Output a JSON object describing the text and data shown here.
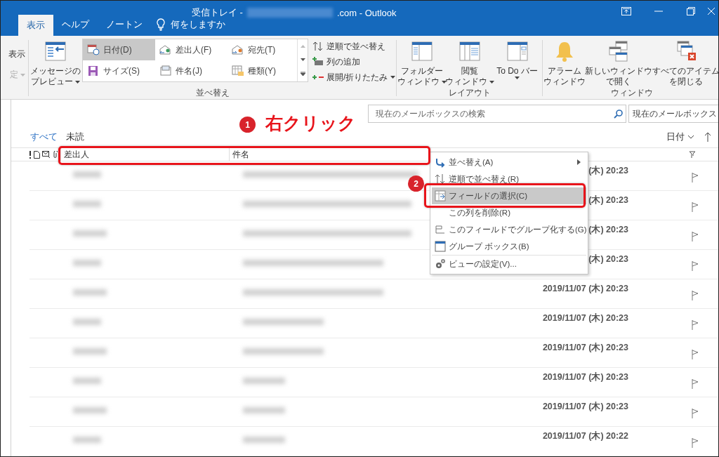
{
  "window": {
    "title_prefix": "受信トレイ -",
    "title_suffix": ".com - Outlook"
  },
  "ribbon_tabs": [
    {
      "label": "表示",
      "selected": true
    },
    {
      "label": "ヘルプ",
      "selected": false
    },
    {
      "label": "ノートン",
      "selected": false
    }
  ],
  "tell_me": "何をしますか",
  "ribbon": {
    "cut_group": [
      {
        "label": "表示",
        "disabled": false,
        "dropdown": false
      },
      {
        "label": "定",
        "disabled": true,
        "dropdown": true
      }
    ],
    "preview_button": {
      "lines": [
        "メッセージの",
        "プレビュー"
      ],
      "dropdown": true
    },
    "arrangement": {
      "label": "並べ替え",
      "items": [
        {
          "label": "日付(D)",
          "selected": true
        },
        {
          "label": "差出人(F)",
          "selected": false
        },
        {
          "label": "宛先(T)",
          "selected": false
        },
        {
          "label": "サイズ(S)",
          "selected": false
        },
        {
          "label": "件名(J)",
          "selected": false
        },
        {
          "label": "種類(Y)",
          "selected": false
        }
      ],
      "commands": [
        {
          "label": "逆順で並べ替え",
          "dropdown": false
        },
        {
          "label": "列の追加",
          "dropdown": false
        },
        {
          "label": "展開/折りたたみ",
          "dropdown": true
        }
      ]
    },
    "layout": {
      "label": "レイアウト",
      "buttons": [
        {
          "lines": [
            "フォルダー",
            "ウィンドウ"
          ],
          "dropdown": true
        },
        {
          "lines": [
            "閲覧",
            "ウィンドウ"
          ],
          "dropdown": true
        },
        {
          "lines": [
            "To Do バー"
          ],
          "dropdown": true
        }
      ]
    },
    "window_group": {
      "label": "ウィンドウ",
      "buttons": [
        {
          "lines": [
            "アラーム",
            "ウィンドウ"
          ],
          "dropdown": false
        },
        {
          "lines": [
            "新しいウィンドウ",
            "で開く"
          ],
          "dropdown": false
        },
        {
          "lines": [
            "すべてのアイテム",
            "を閉じる"
          ],
          "dropdown": false
        }
      ]
    }
  },
  "mail_list": {
    "search": {
      "placeholder": "現在のメールボックスの検索"
    },
    "scope": "現在のメールボックス",
    "filters": [
      {
        "label": "すべて",
        "selected": true
      },
      {
        "label": "未読",
        "selected": false
      }
    ],
    "sort": {
      "label": "日付"
    },
    "columns": [
      "差出人",
      "件名"
    ],
    "rows": [
      {
        "date": "(木) 20:23"
      },
      {
        "date": "(木) 20:23"
      },
      {
        "date": "(木) 20:23"
      },
      {
        "date": "(木) 20:23"
      },
      {
        "date": "2019/11/07 (木) 20:23"
      },
      {
        "date": "2019/11/07 (木) 20:23"
      },
      {
        "date": "2019/11/07 (木) 20:23"
      },
      {
        "date": "2019/11/07 (木) 20:23"
      },
      {
        "date": "2019/11/07 (木) 20:23"
      },
      {
        "date": "2019/11/07 (木) 20:22"
      }
    ]
  },
  "context_menu": {
    "items": [
      {
        "label": "並べ替え(A)",
        "highlighted": false,
        "submenu": true,
        "divider_before": false
      },
      {
        "label": "逆順で並べ替え(R)",
        "highlighted": false,
        "submenu": false,
        "divider_before": false
      },
      {
        "label": "フィールドの選択(C)",
        "highlighted": true,
        "submenu": false,
        "divider_before": false
      },
      {
        "label": "この列を削除(R)",
        "highlighted": false,
        "submenu": false,
        "divider_before": false
      },
      {
        "label": "このフィールドでグループ化する(G)",
        "highlighted": false,
        "submenu": false,
        "divider_before": false
      },
      {
        "label": "グループ ボックス(B)",
        "highlighted": false,
        "submenu": false,
        "divider_before": false
      },
      {
        "label": "ビューの設定(V)...",
        "highlighted": false,
        "submenu": false,
        "divider_before": true
      }
    ]
  },
  "annotations": [
    {
      "number": "1",
      "text": "右クリック"
    },
    {
      "number": "2"
    }
  ]
}
